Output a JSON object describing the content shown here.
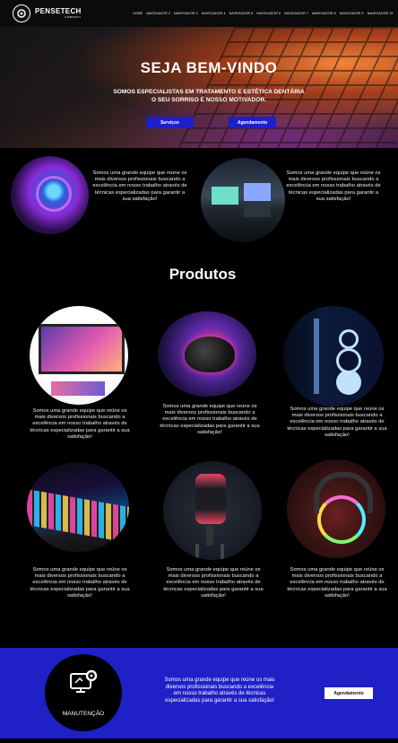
{
  "header": {
    "logo_name": "PENSETECH",
    "logo_sub": "COMPANY",
    "nav": [
      "HOME",
      "NAVEGADOR 2",
      "NAVEGADOR 3",
      "NAVEGADOR 4",
      "NAVEGADOR 5",
      "NAVEGADOR 6",
      "NAVEGADOR 7",
      "NAVEGADOR 8",
      "NAVEGADOR 9",
      "NAVEGADOR 10"
    ]
  },
  "hero": {
    "title": "SEJA BEM-VINDO",
    "subtitle_line1": "SOMOS ESPECIALISTAS EM TRATAMENTO E ESTÉTICA DENTÁRIA",
    "subtitle_line2": "O SEU SORRISO É NOSSO MOTIVADOR.",
    "btn_services": "Serviços",
    "btn_schedule": "Agendamento"
  },
  "intro": {
    "text1": "Somos uma grande equipe que reúne os mais diversos profissionais buscando a excelência em nosso trabalho através de técnicas especializadas para garantir a sua satisfação!",
    "text2": "Somos uma grande equipe que reúne os mais diversos profissionais buscando a excelência em nosso trabalho através de técnicas especializadas para garantir a sua satisfação!"
  },
  "products": {
    "title": "Produtos",
    "items": [
      {
        "text": "Somos uma grande equipe que reúne os mais diversos profissionais buscando a excelência em nosso trabalho através de técnicas especializadas para garantir a sua satisfação!"
      },
      {
        "text": "Somos uma grande equipe que reúne os mais diversos profissionais buscando a excelência em nosso trabalho através de técnicas especializadas para garantir a sua satisfação!"
      },
      {
        "text": "Somos uma grande equipe que reúne os mais diversos profissionais buscando a excelência em nosso trabalho através de técnicas especializadas para garantir a sua satisfação!"
      },
      {
        "text": "Somos uma grande equipe que reúne os mais diversos profissionais buscando a excelência em nosso trabalho através de técnicas especializadas para garantir a sua satisfação!"
      },
      {
        "text": "Somos uma grande equipe que reúne os mais diversos profissionais buscando a excelência em nosso trabalho através de técnicas especializadas para garantir a sua satisfação!"
      },
      {
        "text": "Somos uma grande equipe que reúne os mais diversos profissionais buscando a excelência em nosso trabalho através de técnicas especializadas para garantir a sua satisfação!"
      }
    ]
  },
  "maintenance": {
    "label": "MANUTENÇÃO",
    "text": "Somos uma grande equipe que reúne os mais diversos profissionais buscando a excelência em nosso trabalho através de técnicas especializadas para garantir a sua satisfação!",
    "btn_schedule": "Agendamento"
  },
  "colors": {
    "accent": "#1f20c6",
    "background": "#000000"
  }
}
